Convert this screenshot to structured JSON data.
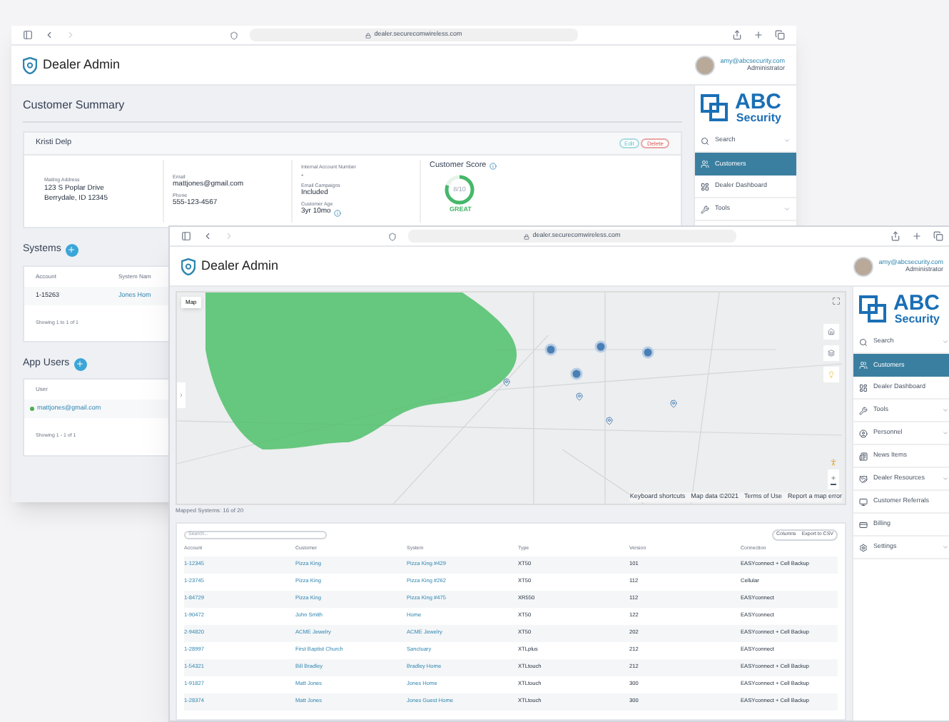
{
  "back_window": {
    "url": "dealer.securecomwireless.com",
    "app_title": "Dealer Admin",
    "user": {
      "email": "amy@abcsecurity.com",
      "role": "Administrator"
    },
    "logo": {
      "line1": "ABC",
      "line2": "Security"
    },
    "sidebar": [
      {
        "label": "Search",
        "selected": false,
        "has_submenu": true
      },
      {
        "label": "Customers",
        "selected": true,
        "has_submenu": false
      },
      {
        "label": "Dealer Dashboard",
        "selected": false,
        "has_submenu": false
      },
      {
        "label": "Tools",
        "selected": false,
        "has_submenu": true
      }
    ],
    "page_title": "Customer Summary",
    "customer": {
      "name": "Kristi Delp",
      "buttons": [
        {
          "label": "Edit",
          "kind": "edit"
        },
        {
          "label": "Delete",
          "kind": "delete"
        }
      ],
      "columns": [
        [
          {
            "label": "Mailing Address",
            "value": "123 S Poplar Drive\nBerrydale, ID 12345",
            "info": false
          }
        ],
        [
          {
            "label": "Email",
            "value": "mattjones@gmail.com",
            "info": false
          },
          {
            "label": "Phone",
            "value": "555-123-4567",
            "info": false
          }
        ],
        [
          {
            "label": "Internal Account Number",
            "value": "-",
            "info": false
          },
          {
            "label": "Email Campaigns",
            "value": "Included",
            "info": false
          },
          {
            "label": "Customer Age",
            "value": "3yr 10mo",
            "info": true
          }
        ]
      ],
      "score": {
        "title": "Customer Score",
        "value": "8/10",
        "rating": "GREAT",
        "level": 0.8
      }
    },
    "systems": {
      "title": "Systems",
      "columns": [
        "Account",
        "System Nam"
      ],
      "rows": [
        [
          "1-15263",
          "Jones Hom"
        ]
      ],
      "footer": "Showing 1 to 1 of 1"
    },
    "app_users": {
      "title": "App Users",
      "columns": [
        "User"
      ],
      "rows": [
        {
          "user": "mattjones@gmail.com",
          "color": "#4caf50"
        }
      ],
      "footer": "Showing 1 - 1 of 1"
    }
  },
  "front_window": {
    "url": "dealer.securecomwireless.com",
    "app_title": "Dealer Admin",
    "user": {
      "email": "amy@abcsecurity.com",
      "role": "Administrator"
    },
    "logo": {
      "line1": "ABC",
      "line2": "Security"
    },
    "sidebar": [
      {
        "label": "Search",
        "selected": false,
        "has_submenu": true
      },
      {
        "label": "Customers",
        "selected": true,
        "has_submenu": false
      },
      {
        "label": "Dealer Dashboard",
        "selected": false,
        "has_submenu": false
      },
      {
        "label": "Tools",
        "selected": false,
        "has_submenu": true
      },
      {
        "label": "Personnel",
        "selected": false,
        "has_submenu": true
      },
      {
        "label": "News Items",
        "selected": false,
        "has_submenu": false
      },
      {
        "label": "Dealer Resources",
        "selected": false,
        "has_submenu": true
      },
      {
        "label": "Customer Referrals",
        "selected": false,
        "has_submenu": false
      },
      {
        "label": "Billing",
        "selected": false,
        "has_submenu": false
      },
      {
        "label": "Settings",
        "selected": false,
        "has_submenu": true
      }
    ],
    "map": {
      "type_label": "Map",
      "attribution": [
        "Keyboard shortcuts",
        "Map data ©2021",
        "Terms of Use",
        "Report a map error"
      ],
      "caption": "Mapped Systems: 16 of 20"
    },
    "table": {
      "search_placeholder": "Search...",
      "buttons": [
        "Columns",
        "Export to CSV"
      ],
      "columns": [
        "Account",
        "Customer",
        "System",
        "Type",
        "Version",
        "Connection"
      ],
      "rows": [
        [
          "1-12345",
          "Pizza King",
          "Pizza King #429",
          "XT50",
          "101",
          "EASYconnect + Cell Backup"
        ],
        [
          "1-23745",
          "Pizza King",
          "Pizza King #262",
          "XT50",
          "112",
          "Cellular"
        ],
        [
          "1-84729",
          "Pizza King",
          "Pizza King #475",
          "XR550",
          "112",
          "EASYconnect"
        ],
        [
          "1-90472",
          "John Smith",
          "Home",
          "XT50",
          "122",
          "EASYconnect"
        ],
        [
          "2-94820",
          "ACME Jewelry",
          "ACME Jewelry",
          "XT50",
          "202",
          "EASYconnect + Cell Backup"
        ],
        [
          "1-28997",
          "First Baptist Church",
          "Sanctuary",
          "XTLplus",
          "212",
          "EASYconnect"
        ],
        [
          "1-54321",
          "Bill Bradley",
          "Bradley Home",
          "XTLtouch",
          "212",
          "EASYconnect + Cell Backup"
        ],
        [
          "1-91827",
          "Matt Jones",
          "Jones Home",
          "XTLtouch",
          "300",
          "EASYconnect + Cell Backup"
        ],
        [
          "1-28374",
          "Matt Jones",
          "Jones Guest Home",
          "XTLtouch",
          "300",
          "EASYconnect + Cell Backup"
        ]
      ]
    }
  }
}
